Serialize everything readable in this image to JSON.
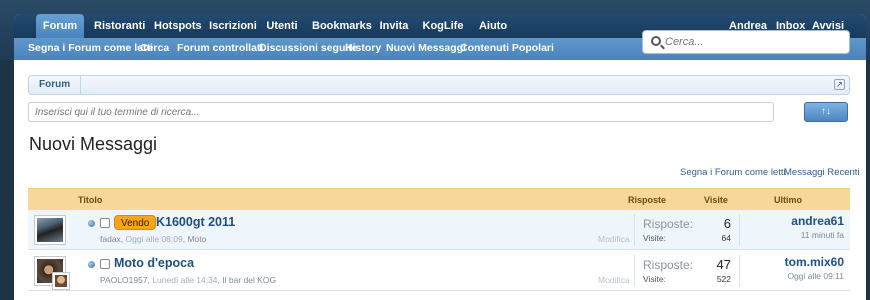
{
  "nav": {
    "tabs": [
      {
        "label": "Forum",
        "selected": true
      },
      {
        "label": "Ristoranti"
      },
      {
        "label": "Hotspots"
      },
      {
        "label": "Iscrizioni"
      },
      {
        "label": "Utenti"
      },
      {
        "label": "Bookmarks"
      },
      {
        "label": "Invita"
      },
      {
        "label": "KogLife"
      },
      {
        "label": "Aiuto"
      }
    ],
    "user": {
      "name": "Andrea",
      "inbox": "Inbox",
      "alerts": "Avvisi"
    },
    "sublinks": [
      "Segna i Forum come letti",
      "Cerca",
      "Forum controllati",
      "Discussioni seguite",
      "History",
      "Nuovi Messaggi",
      "Contenuti Popolari"
    ],
    "search_placeholder": "Cerca..."
  },
  "breadcrumb": {
    "home": "Forum"
  },
  "filter": {
    "placeholder": "Inserisci qui il tuo termine di ricerca...",
    "sort_label": "↑↓"
  },
  "page_title": "Nuovi Messaggi",
  "page_links": {
    "mark_read": "Segna i Forum come letti",
    "recent": "Messaggi Recenti"
  },
  "table": {
    "headers": {
      "title": "Titolo",
      "replies": "Risposte",
      "views": "Visite",
      "last": "Ultimo Messaggio"
    },
    "rows": [
      {
        "prefix": "Vendo",
        "title": "K1600gt 2011",
        "author": "fadax",
        "date": "Oggi alle 08:09",
        "forum": "Moto",
        "edit": "Modifica",
        "replies_label": "Risposte:",
        "replies": "6",
        "views_label": "Visite:",
        "views": "64",
        "last_user": "andrea61",
        "last_time": "11 minuti fa"
      },
      {
        "prefix": "",
        "title": "Moto d'epoca",
        "author": "PAOLO1957",
        "date": "Lunedì alle 14:34",
        "forum": "Il bar del KOG",
        "edit": "Modifica",
        "replies_label": "Risposte:",
        "replies": "47",
        "views_label": "Visite:",
        "views": "522",
        "last_user": "tom.mix60",
        "last_time": "Oggi alle 09:11"
      }
    ]
  },
  "colors": {
    "accent": "#4a84bd",
    "header_row": "#f8d79a",
    "prefix": "#f6a61a"
  }
}
